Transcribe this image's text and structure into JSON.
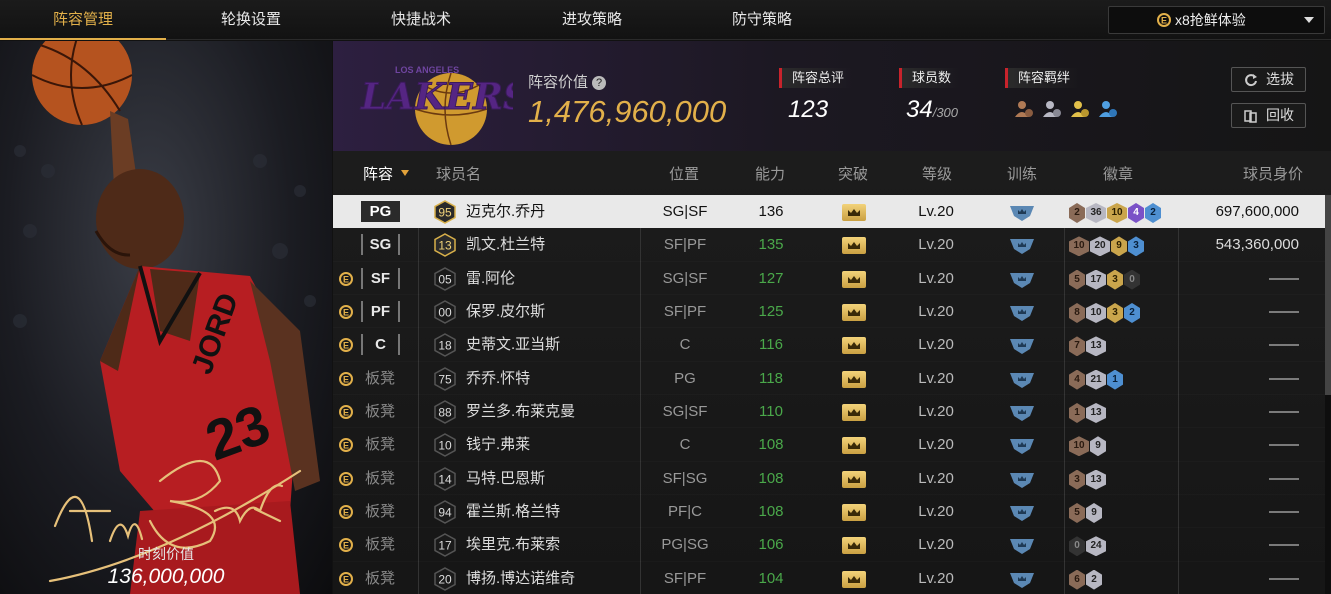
{
  "nav": {
    "tabs": [
      {
        "label": "阵容管理",
        "active": true
      },
      {
        "label": "轮换设置",
        "active": false
      },
      {
        "label": "快捷战术",
        "active": false
      },
      {
        "label": "进攻策略",
        "active": false
      },
      {
        "label": "防守策略",
        "active": false
      }
    ],
    "dropdown_label": "x8抢鲜体验"
  },
  "hero": {
    "signature": "I'm Back",
    "moment_value_label": "时刻价值",
    "moment_value": "136,000,000",
    "jersey_text": "JORD",
    "jersey_number": "23"
  },
  "team": {
    "logo_text": "LAKERS",
    "logo_subtext": "LOS ANGELES",
    "value_label": "阵容价值",
    "value": "1,476,960,000",
    "rating_label": "阵容总评",
    "rating": "123",
    "players_label": "球员数",
    "players_count": "34",
    "players_max": "/300",
    "bonds_label": "阵容羁绊",
    "reselect_label": "选拔",
    "recycle_label": "回收"
  },
  "table": {
    "headers": {
      "lineup": "阵容",
      "name": "球员名",
      "position": "位置",
      "ability": "能力",
      "breakthrough": "突破",
      "level": "等级",
      "training": "训练",
      "badges": "徽章",
      "value": "球员身价"
    },
    "rows": [
      {
        "slot": "PG",
        "coin": false,
        "rank": "95",
        "name": "迈克尔.乔丹",
        "pos": "SG|SF",
        "ability": "136",
        "level": "Lv.20",
        "badges": [
          [
            "2",
            "b0"
          ],
          [
            "36",
            "b1"
          ],
          [
            "10",
            "b2"
          ],
          [
            "4",
            "b3"
          ],
          [
            "2",
            "b4"
          ]
        ],
        "value": "697,600,000",
        "selected": true
      },
      {
        "slot": "SG",
        "coin": false,
        "rank": "13",
        "name": "凯文.杜兰特",
        "pos": "SF|PF",
        "ability": "135",
        "level": "Lv.20",
        "badges": [
          [
            "10",
            "b0"
          ],
          [
            "20",
            "b1"
          ],
          [
            "9",
            "b2"
          ],
          [
            "3",
            "b4"
          ]
        ],
        "value": "543,360,000",
        "selected": false
      },
      {
        "slot": "SF",
        "coin": true,
        "rank": "05",
        "name": "雷.阿伦",
        "pos": "SG|SF",
        "ability": "127",
        "level": "Lv.20",
        "badges": [
          [
            "5",
            "b0"
          ],
          [
            "17",
            "b1"
          ],
          [
            "3",
            "b2"
          ],
          [
            "0",
            "b5"
          ]
        ],
        "value": "——",
        "selected": false
      },
      {
        "slot": "PF",
        "coin": true,
        "rank": "00",
        "name": "保罗.皮尔斯",
        "pos": "SF|PF",
        "ability": "125",
        "level": "Lv.20",
        "badges": [
          [
            "8",
            "b0"
          ],
          [
            "10",
            "b1"
          ],
          [
            "3",
            "b2"
          ],
          [
            "2",
            "b4"
          ]
        ],
        "value": "——",
        "selected": false
      },
      {
        "slot": "C",
        "coin": true,
        "rank": "18",
        "name": "史蒂文.亚当斯",
        "pos": "C",
        "ability": "116",
        "level": "Lv.20",
        "badges": [
          [
            "7",
            "b0"
          ],
          [
            "13",
            "b1"
          ]
        ],
        "value": "——",
        "selected": false
      },
      {
        "slot": "板凳",
        "coin": true,
        "rank": "75",
        "name": "乔乔.怀特",
        "pos": "PG",
        "ability": "118",
        "level": "Lv.20",
        "badges": [
          [
            "4",
            "b0"
          ],
          [
            "21",
            "b1"
          ],
          [
            "1",
            "b4"
          ]
        ],
        "value": "——",
        "selected": false
      },
      {
        "slot": "板凳",
        "coin": true,
        "rank": "88",
        "name": "罗兰多.布莱克曼",
        "pos": "SG|SF",
        "ability": "110",
        "level": "Lv.20",
        "badges": [
          [
            "1",
            "b0"
          ],
          [
            "13",
            "b1"
          ]
        ],
        "value": "——",
        "selected": false
      },
      {
        "slot": "板凳",
        "coin": true,
        "rank": "10",
        "name": "钱宁.弗莱",
        "pos": "C",
        "ability": "108",
        "level": "Lv.20",
        "badges": [
          [
            "10",
            "b0"
          ],
          [
            "9",
            "b1"
          ]
        ],
        "value": "——",
        "selected": false
      },
      {
        "slot": "板凳",
        "coin": true,
        "rank": "14",
        "name": "马特.巴恩斯",
        "pos": "SF|SG",
        "ability": "108",
        "level": "Lv.20",
        "badges": [
          [
            "3",
            "b0"
          ],
          [
            "13",
            "b1"
          ]
        ],
        "value": "——",
        "selected": false
      },
      {
        "slot": "板凳",
        "coin": true,
        "rank": "94",
        "name": "霍兰斯.格兰特",
        "pos": "PF|C",
        "ability": "108",
        "level": "Lv.20",
        "badges": [
          [
            "5",
            "b0"
          ],
          [
            "9",
            "b1"
          ]
        ],
        "value": "——",
        "selected": false
      },
      {
        "slot": "板凳",
        "coin": true,
        "rank": "17",
        "name": "埃里克.布莱索",
        "pos": "PG|SG",
        "ability": "106",
        "level": "Lv.20",
        "badges": [
          [
            "0",
            "b5"
          ],
          [
            "24",
            "b1"
          ]
        ],
        "value": "——",
        "selected": false
      },
      {
        "slot": "板凳",
        "coin": true,
        "rank": "20",
        "name": "博扬.博达诺维奇",
        "pos": "SF|PF",
        "ability": "104",
        "level": "Lv.20",
        "badges": [
          [
            "6",
            "b0"
          ],
          [
            "2",
            "b1"
          ]
        ],
        "value": "——",
        "selected": false
      }
    ]
  },
  "colors": {
    "accent_gold": "#e2b04a",
    "ability_green": "#4aa84a",
    "label_red": "#c8232c",
    "lakers_purple": "#552583"
  }
}
